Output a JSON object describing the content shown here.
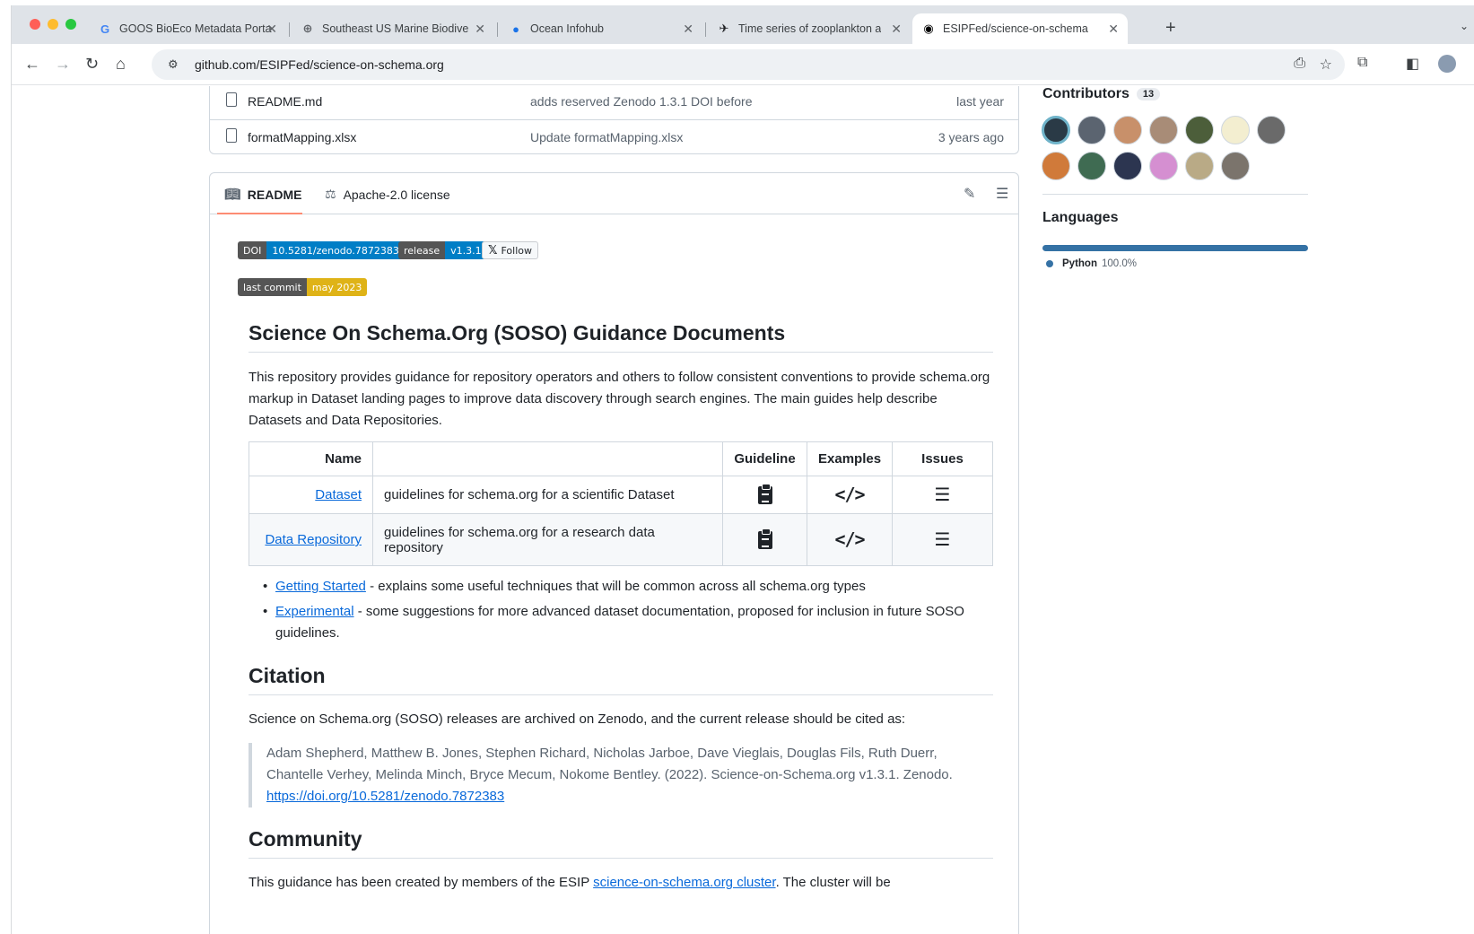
{
  "browser": {
    "tabs": [
      {
        "title": "GOOS BioEco Metadata Porta",
        "icon": "google-g-icon"
      },
      {
        "title": "Southeast US Marine Biodive",
        "icon": "globe-icon"
      },
      {
        "title": "Ocean Infohub",
        "icon": "ocean-logo-icon"
      },
      {
        "title": "Time series of zooplankton a",
        "icon": "plane-icon"
      },
      {
        "title": "ESIPFed/science-on-schema",
        "icon": "github-icon"
      }
    ],
    "url": "github.com/ESIPFed/science-on-schema.org"
  },
  "files": [
    {
      "name": "README.md",
      "message": "adds reserved Zenodo 1.3.1 DOI before",
      "date": "last year"
    },
    {
      "name": "formatMapping.xlsx",
      "message": "Update formatMapping.xlsx",
      "date": "3 years ago"
    }
  ],
  "readme_tabs": {
    "readme": "README",
    "license": "Apache-2.0 license"
  },
  "badges": {
    "doi_label": "DOI",
    "doi_value": "10.5281/zenodo.7872383",
    "release_label": "release",
    "release_value": "v1.3.1",
    "follow": "Follow",
    "commit_label": "last commit",
    "commit_value": "may 2023",
    "colors": {
      "doi": "#007ec6",
      "release": "#007ec6",
      "commit": "#dfb317"
    }
  },
  "readme": {
    "title": "Science On Schema.Org (SOSO) Guidance Documents",
    "intro": "This repository provides guidance for repository operators and others to follow consistent conventions to provide schema.org markup in Dataset landing pages to improve data discovery through search engines. The main guides help describe Datasets and Data Repositories.",
    "table": {
      "headers": [
        "Name",
        "",
        "Guideline",
        "Examples",
        "Issues"
      ],
      "rows": [
        {
          "name": "Dataset",
          "desc": "guidelines for schema.org for a scientific Dataset"
        },
        {
          "name": "Data Repository",
          "desc": "guidelines for schema.org for a research data repository"
        }
      ]
    },
    "bullets": [
      {
        "link": "Getting Started",
        "text": " - explains some useful techniques that will be common across all schema.org types"
      },
      {
        "link": "Experimental",
        "text": " - some suggestions for more advanced dataset documentation, proposed for inclusion in future SOSO guidelines."
      }
    ],
    "citation_title": "Citation",
    "citation_intro": "Science on Schema.org (SOSO) releases are archived on Zenodo, and the current release should be cited as:",
    "citation_quote": "Adam Shepherd, Matthew B. Jones, Stephen Richard, Nicholas Jarboe, Dave Vieglais, Douglas Fils, Ruth Duerr, Chantelle Verhey, Melinda Minch, Bryce Mecum, Nokome Bentley. (2022). Science-on-Schema.org v1.3.1. Zenodo. ",
    "citation_link": "https://doi.org/10.5281/zenodo.7872383",
    "community_title": "Community",
    "community_text_pre": "This guidance has been created by members of the ESIP ",
    "community_link": "science-on-schema.org cluster",
    "community_text_post": ". The cluster will be"
  },
  "sidebar": {
    "contributors_title": "Contributors",
    "contributors_count": "13",
    "languages_title": "Languages",
    "language": {
      "name": "Python",
      "percent": "100.0%",
      "color": "#3572A5"
    }
  }
}
